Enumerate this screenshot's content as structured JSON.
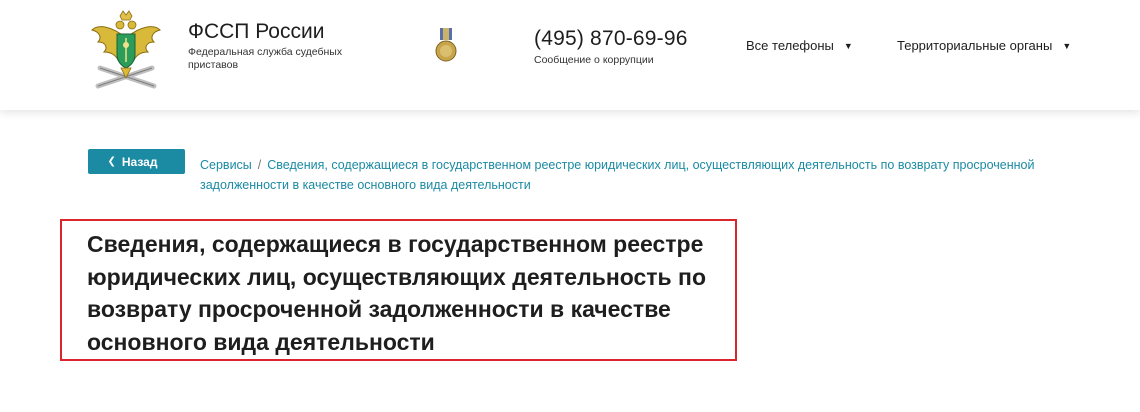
{
  "header": {
    "org_name": "ФССП России",
    "org_subtitle": "Федеральная служба судебных приставов",
    "phone": "(495) 870-69-96",
    "phone_caption": "Сообщение о коррупции",
    "nav": [
      {
        "label": "Все телефоны",
        "icon": "caret-down-icon"
      },
      {
        "label": "Территориальные органы",
        "icon": "caret-down-icon"
      }
    ],
    "logo_icon": "fssp-eagle-emblem-icon",
    "medal_icon": "medal-icon"
  },
  "back_button": {
    "label": "Назад",
    "icon": "chevron-left-icon"
  },
  "breadcrumb": {
    "items": [
      "Сервисы",
      "Сведения, содержащиеся в государственном реестре юридических лиц, осуществляющих деятельность по возврату просроченной задолженности в качестве основного вида деятельности"
    ],
    "separator": "/"
  },
  "page_title": "Сведения, содержащиеся в государственном реестре юридических лиц, осуществляющих деятельность по возврату просроченной задолженности в качестве основного вида деятельности",
  "colors": {
    "accent": "#1b8aa3",
    "highlight_border": "#d8262c",
    "text": "#1e1e1e"
  }
}
